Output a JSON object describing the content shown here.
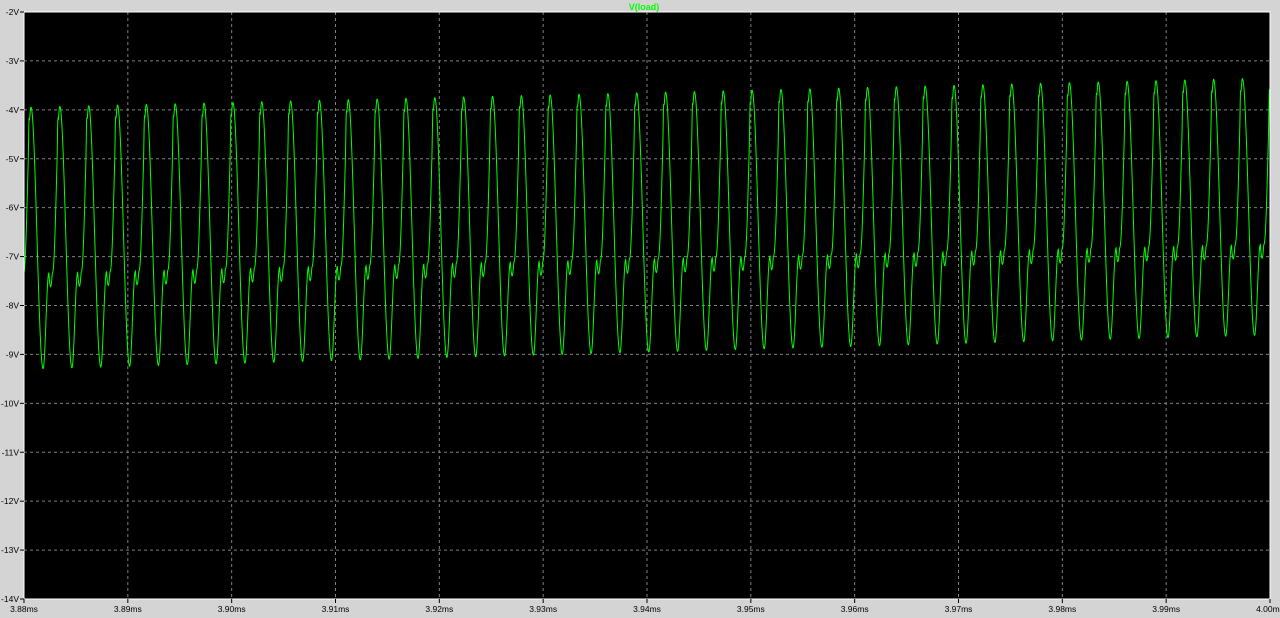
{
  "window": {
    "background": "#d4d4d4",
    "plot_background": "#000000",
    "grid_color": "#7f7f7f",
    "frame_color": "#ffffff"
  },
  "chart_data": {
    "type": "line",
    "title": "",
    "xlabel": "",
    "ylabel": "",
    "grid": true,
    "xlim": [
      3.88,
      4.0
    ],
    "ylim": [
      -14,
      -2
    ],
    "x_ticks": [
      3.88,
      3.89,
      3.9,
      3.91,
      3.92,
      3.93,
      3.94,
      3.95,
      3.96,
      3.97,
      3.98,
      3.99,
      4.0
    ],
    "x_tick_labels": [
      "3.88ms",
      "3.89ms",
      "3.90ms",
      "3.91ms",
      "3.92ms",
      "3.93ms",
      "3.94ms",
      "3.95ms",
      "3.96ms",
      "3.97ms",
      "3.98ms",
      "3.99ms",
      "4.00ms"
    ],
    "y_ticks": [
      -2,
      -3,
      -4,
      -5,
      -6,
      -7,
      -8,
      -9,
      -10,
      -11,
      -12,
      -13,
      -14
    ],
    "y_tick_labels": [
      "-2V",
      "-3V",
      "-4V",
      "-5V",
      "-6V",
      "-7V",
      "-8V",
      "-9V",
      "-10V",
      "-11V",
      "-12V",
      "-13V",
      "-14V"
    ],
    "series": [
      {
        "name": "V(load)",
        "color": "#00ff00",
        "period_ms": 0.002778,
        "start_ms": 3.88,
        "end_ms": 4.0,
        "peak_v": [
          -3.95,
          -3.35
        ],
        "trough_v": [
          -9.3,
          -8.6
        ],
        "shoulder_v": [
          -7.35,
          -6.75
        ],
        "waveform": "periodic pulse with sharp peak, deep trough and secondary shoulder bump"
      }
    ]
  }
}
